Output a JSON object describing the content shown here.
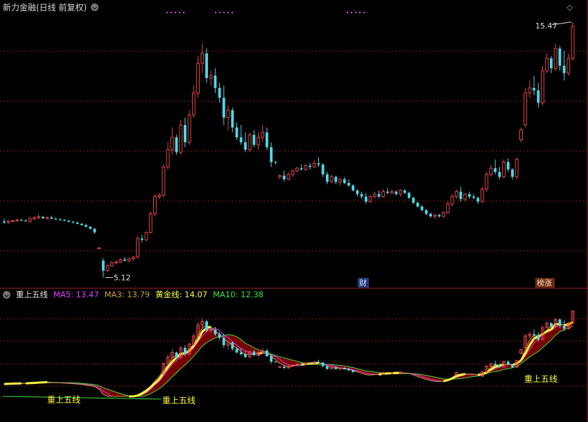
{
  "header": {
    "title": "新力金融(日线 前复权)",
    "collapse_icon": "chevron-down-icon"
  },
  "corner_icon": "diamond-icon",
  "main_chart": {
    "max_label": "15.47",
    "min_label": "5.12",
    "badges": [
      {
        "text": "财"
      },
      {
        "text": "榜涨"
      }
    ]
  },
  "indicator": {
    "name": "重上五线",
    "ma5_label": "MA5: 13.47",
    "ma3_label": "MA3: 13.79",
    "gold_label": "黄金线: 14.07",
    "ma10_label": "MA10: 12.38",
    "signals": [
      {
        "text": "重上五线"
      },
      {
        "text": "重上五线"
      },
      {
        "text": "重上五线"
      }
    ]
  },
  "colors": {
    "up": "#e64545",
    "down": "#4fd8e8",
    "grid": "#8b1a1a",
    "ma5": "#e040fb",
    "ma3": "#c8a040",
    "gold": "#ffff40",
    "ma10": "#40e040",
    "fill": "#8b0000"
  },
  "chart_data": {
    "type": "candlestick",
    "title": "新力金融(日线 前复权)",
    "series": [
      {
        "name": "新力金融",
        "ohlc": [
          [
            7.4,
            7.5,
            7.3,
            7.35
          ],
          [
            7.35,
            7.45,
            7.3,
            7.4
          ],
          [
            7.4,
            7.45,
            7.35,
            7.42
          ],
          [
            7.42,
            7.5,
            7.38,
            7.45
          ],
          [
            7.45,
            7.5,
            7.4,
            7.43
          ],
          [
            7.43,
            7.48,
            7.38,
            7.4
          ],
          [
            7.4,
            7.6,
            7.35,
            7.5
          ],
          [
            7.5,
            7.6,
            7.45,
            7.55
          ],
          [
            7.55,
            7.7,
            7.5,
            7.58
          ],
          [
            7.58,
            7.62,
            7.5,
            7.52
          ],
          [
            7.52,
            7.6,
            7.48,
            7.55
          ],
          [
            7.55,
            7.62,
            7.5,
            7.5
          ],
          [
            7.5,
            7.55,
            7.45,
            7.48
          ],
          [
            7.48,
            7.52,
            7.42,
            7.45
          ],
          [
            7.45,
            7.5,
            7.4,
            7.42
          ],
          [
            7.42,
            7.46,
            7.36,
            7.38
          ],
          [
            7.38,
            7.42,
            7.32,
            7.35
          ],
          [
            7.35,
            7.38,
            7.28,
            7.3
          ],
          [
            7.3,
            7.33,
            7.22,
            7.25
          ],
          [
            7.25,
            7.28,
            7.15,
            7.18
          ],
          [
            7.18,
            7.2,
            7.05,
            7.1
          ],
          [
            7.1,
            7.12,
            6.9,
            6.95
          ],
          [
            6.3,
            6.35,
            6.28,
            6.32
          ],
          [
            5.8,
            5.9,
            5.12,
            5.4
          ],
          [
            5.4,
            5.65,
            5.35,
            5.6
          ],
          [
            5.6,
            5.8,
            5.55,
            5.72
          ],
          [
            5.72,
            5.82,
            5.65,
            5.75
          ],
          [
            5.75,
            5.9,
            5.7,
            5.85
          ],
          [
            5.85,
            5.95,
            5.78,
            5.8
          ],
          [
            5.8,
            5.92,
            5.75,
            5.88
          ],
          [
            5.88,
            6.0,
            5.8,
            5.95
          ],
          [
            5.95,
            6.8,
            5.9,
            6.7
          ],
          [
            6.7,
            6.85,
            6.55,
            6.65
          ],
          [
            6.65,
            7.0,
            6.6,
            6.95
          ],
          [
            6.95,
            7.8,
            6.9,
            7.7
          ],
          [
            7.7,
            8.5,
            7.6,
            8.4
          ],
          [
            8.4,
            8.55,
            8.3,
            8.45
          ],
          [
            8.45,
            9.7,
            8.4,
            9.6
          ],
          [
            9.6,
            10.6,
            9.5,
            10.3
          ],
          [
            10.3,
            11.2,
            10.1,
            10.8
          ],
          [
            10.8,
            10.9,
            10.1,
            10.2
          ],
          [
            10.2,
            11.5,
            10.1,
            11.3
          ],
          [
            11.3,
            11.6,
            10.4,
            10.6
          ],
          [
            10.6,
            11.9,
            10.5,
            11.7
          ],
          [
            11.7,
            12.9,
            11.6,
            12.6
          ],
          [
            12.6,
            14.1,
            12.4,
            13.8
          ],
          [
            13.8,
            14.6,
            13.4,
            14.2
          ],
          [
            14.2,
            14.4,
            13.0,
            13.2
          ],
          [
            13.2,
            13.5,
            12.9,
            13.3
          ],
          [
            13.3,
            13.6,
            12.6,
            12.8
          ],
          [
            12.8,
            13.0,
            12.2,
            12.4
          ],
          [
            12.4,
            12.9,
            11.3,
            11.6
          ],
          [
            11.6,
            12.1,
            11.1,
            11.9
          ],
          [
            11.9,
            12.0,
            11.0,
            11.2
          ],
          [
            11.2,
            11.4,
            10.7,
            10.8
          ],
          [
            10.8,
            11.3,
            10.5,
            10.6
          ],
          [
            10.6,
            11.0,
            10.2,
            10.3
          ],
          [
            10.3,
            11.0,
            10.2,
            10.9
          ],
          [
            10.9,
            11.1,
            10.4,
            10.5
          ],
          [
            10.5,
            11.0,
            10.3,
            10.8
          ],
          [
            10.8,
            11.3,
            10.6,
            11.0
          ],
          [
            11.0,
            11.2,
            10.3,
            10.4
          ],
          [
            10.4,
            10.6,
            9.6,
            9.8
          ],
          [
            9.8,
            9.85,
            9.7,
            9.78
          ],
          [
            9.2,
            9.3,
            9.1,
            9.25
          ],
          [
            9.25,
            9.45,
            9.0,
            9.1
          ],
          [
            9.1,
            9.4,
            9.05,
            9.3
          ],
          [
            9.3,
            9.5,
            9.2,
            9.45
          ],
          [
            9.45,
            9.6,
            9.4,
            9.55
          ],
          [
            9.55,
            9.7,
            9.45,
            9.5
          ],
          [
            9.5,
            9.7,
            9.45,
            9.65
          ],
          [
            9.65,
            9.75,
            9.5,
            9.6
          ],
          [
            9.6,
            9.85,
            9.55,
            9.75
          ],
          [
            9.75,
            10.0,
            9.6,
            9.7
          ],
          [
            9.7,
            9.75,
            9.2,
            9.3
          ],
          [
            9.3,
            9.4,
            8.9,
            9.0
          ],
          [
            9.0,
            9.3,
            8.95,
            9.2
          ],
          [
            9.2,
            9.25,
            8.9,
            9.0
          ],
          [
            9.0,
            9.15,
            8.85,
            9.1
          ],
          [
            9.1,
            9.2,
            8.9,
            8.95
          ],
          [
            8.95,
            9.1,
            8.8,
            8.85
          ],
          [
            8.85,
            8.9,
            8.6,
            8.65
          ],
          [
            8.65,
            8.7,
            8.4,
            8.5
          ],
          [
            8.5,
            8.6,
            8.3,
            8.4
          ],
          [
            8.4,
            8.55,
            8.1,
            8.2
          ],
          [
            8.2,
            8.45,
            8.15,
            8.4
          ],
          [
            8.4,
            8.6,
            8.3,
            8.5
          ],
          [
            8.5,
            8.65,
            8.35,
            8.4
          ],
          [
            8.4,
            8.7,
            8.35,
            8.6
          ],
          [
            8.6,
            8.75,
            8.5,
            8.55
          ],
          [
            8.55,
            8.7,
            8.5,
            8.6
          ],
          [
            8.6,
            8.65,
            8.45,
            8.5
          ],
          [
            8.5,
            8.7,
            8.4,
            8.65
          ],
          [
            8.65,
            8.7,
            8.5,
            8.55
          ],
          [
            8.55,
            8.6,
            8.3,
            8.35
          ],
          [
            8.35,
            8.4,
            8.1,
            8.15
          ],
          [
            8.15,
            8.2,
            7.95,
            8.0
          ],
          [
            8.0,
            8.05,
            7.8,
            7.85
          ],
          [
            7.85,
            7.9,
            7.65,
            7.7
          ],
          [
            7.7,
            7.75,
            7.55,
            7.6
          ],
          [
            7.6,
            7.7,
            7.5,
            7.65
          ],
          [
            7.65,
            7.7,
            7.55,
            7.6
          ],
          [
            7.6,
            7.8,
            7.55,
            7.75
          ],
          [
            7.75,
            8.2,
            7.7,
            8.1
          ],
          [
            8.1,
            8.5,
            8.0,
            8.4
          ],
          [
            8.4,
            8.7,
            8.3,
            8.6
          ],
          [
            8.6,
            8.8,
            8.2,
            8.3
          ],
          [
            8.3,
            8.55,
            8.2,
            8.5
          ],
          [
            8.5,
            8.6,
            8.3,
            8.4
          ],
          [
            8.4,
            8.5,
            8.3,
            8.35
          ],
          [
            8.35,
            8.4,
            8.1,
            8.2
          ],
          [
            8.2,
            8.8,
            8.15,
            8.7
          ],
          [
            8.7,
            9.4,
            8.6,
            9.3
          ],
          [
            9.3,
            9.7,
            9.2,
            9.55
          ],
          [
            9.55,
            9.9,
            9.3,
            9.4
          ],
          [
            9.4,
            9.6,
            9.1,
            9.2
          ],
          [
            9.2,
            9.9,
            9.15,
            9.8
          ],
          [
            9.8,
            9.95,
            9.4,
            9.5
          ],
          [
            9.5,
            9.55,
            9.1,
            9.2
          ],
          [
            9.2,
            10.0,
            9.1,
            9.9
          ],
          [
            10.7,
            11.2,
            10.6,
            11.1
          ],
          [
            11.3,
            12.8,
            11.2,
            12.6
          ],
          [
            12.6,
            13.1,
            12.4,
            12.8
          ],
          [
            12.8,
            13.3,
            12.5,
            12.7
          ],
          [
            12.7,
            13.0,
            12.0,
            12.2
          ],
          [
            12.2,
            13.7,
            12.1,
            13.5
          ],
          [
            13.5,
            14.2,
            13.4,
            14.0
          ],
          [
            14.0,
            14.1,
            13.4,
            13.6
          ],
          [
            13.6,
            14.6,
            13.5,
            14.4
          ],
          [
            14.4,
            14.5,
            13.5,
            13.7
          ],
          [
            13.7,
            14.3,
            13.1,
            13.4
          ],
          [
            13.4,
            14.2,
            13.3,
            14.0
          ],
          [
            14.0,
            15.47,
            13.9,
            15.3
          ]
        ]
      }
    ],
    "y_markers": {
      "high": 15.47,
      "low": 5.12
    },
    "indicator_lines": [
      "MA5",
      "MA3",
      "黄金线",
      "MA10"
    ]
  }
}
